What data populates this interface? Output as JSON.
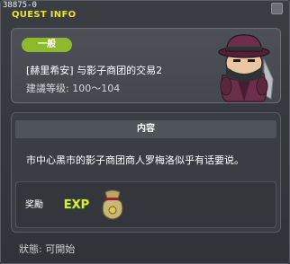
{
  "window": {
    "quest_id": "38875-0",
    "title": "QUEST INFO"
  },
  "quest": {
    "category_badge": "一般",
    "name": "[赫里希安] 与影子商团的交易2",
    "level_requirement": "建議等级: 100～104"
  },
  "content": {
    "header": "内容",
    "description": "市中心黑市的影子商团商人罗梅洛似乎有话要说。"
  },
  "reward": {
    "label": "奖勵",
    "items": [
      {
        "icon": "exp-icon",
        "label": "EXP"
      },
      {
        "icon": "meso-bag-icon"
      }
    ]
  },
  "status": {
    "text": "狀態: 可開始"
  },
  "colors": {
    "title": "#e8e23a",
    "badge": "#8fb92d",
    "exp_text": "#e5e24a"
  }
}
